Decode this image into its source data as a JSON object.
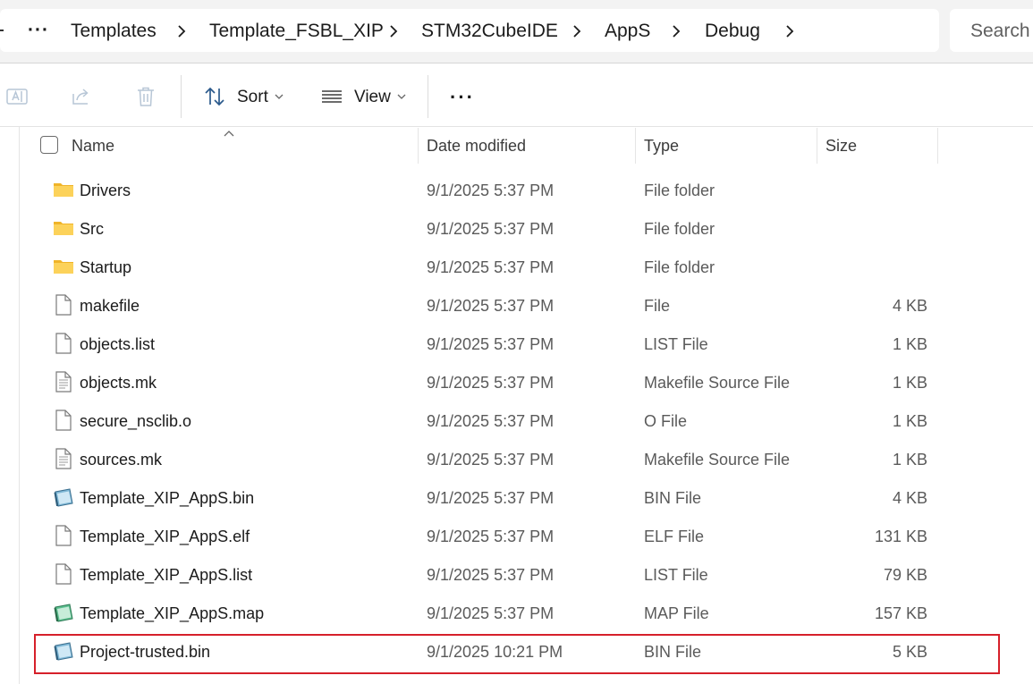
{
  "breadcrumb": {
    "more": "···",
    "items": [
      "Templates",
      "Template_FSBL_XIP",
      "STM32CubeIDE",
      "AppS",
      "Debug"
    ]
  },
  "search": {
    "placeholder": "Search I"
  },
  "toolbar": {
    "sort_label": "Sort",
    "view_label": "View",
    "more_label": "···"
  },
  "columns": {
    "name": "Name",
    "date": "Date modified",
    "type": "Type",
    "size": "Size"
  },
  "files": [
    {
      "name": "Drivers",
      "date": "9/1/2025 5:37 PM",
      "type": "File folder",
      "size": "",
      "icon": "folder-icon"
    },
    {
      "name": "Src",
      "date": "9/1/2025 5:37 PM",
      "type": "File folder",
      "size": "",
      "icon": "folder-icon"
    },
    {
      "name": "Startup",
      "date": "9/1/2025 5:37 PM",
      "type": "File folder",
      "size": "",
      "icon": "folder-icon"
    },
    {
      "name": "makefile",
      "date": "9/1/2025 5:37 PM",
      "type": "File",
      "size": "4 KB",
      "icon": "file-icon"
    },
    {
      "name": "objects.list",
      "date": "9/1/2025 5:37 PM",
      "type": "LIST File",
      "size": "1 KB",
      "icon": "file-icon"
    },
    {
      "name": "objects.mk",
      "date": "9/1/2025 5:37 PM",
      "type": "Makefile Source File",
      "size": "1 KB",
      "icon": "text-file-icon"
    },
    {
      "name": "secure_nsclib.o",
      "date": "9/1/2025 5:37 PM",
      "type": "O File",
      "size": "1 KB",
      "icon": "file-icon"
    },
    {
      "name": "sources.mk",
      "date": "9/1/2025 5:37 PM",
      "type": "Makefile Source File",
      "size": "1 KB",
      "icon": "text-file-icon"
    },
    {
      "name": "Template_XIP_AppS.bin",
      "date": "9/1/2025 5:37 PM",
      "type": "BIN File",
      "size": "4 KB",
      "icon": "bin-file-icon"
    },
    {
      "name": "Template_XIP_AppS.elf",
      "date": "9/1/2025 5:37 PM",
      "type": "ELF File",
      "size": "131 KB",
      "icon": "file-icon"
    },
    {
      "name": "Template_XIP_AppS.list",
      "date": "9/1/2025 5:37 PM",
      "type": "LIST File",
      "size": "79 KB",
      "icon": "file-icon"
    },
    {
      "name": "Template_XIP_AppS.map",
      "date": "9/1/2025 5:37 PM",
      "type": "MAP File",
      "size": "157 KB",
      "icon": "map-file-icon"
    },
    {
      "name": "Project-trusted.bin",
      "date": "9/1/2025 10:21 PM",
      "type": "BIN File",
      "size": "5 KB",
      "icon": "bin-file-icon"
    }
  ],
  "colors": {
    "highlight": "#d6202a",
    "folder": "#f8c33a"
  }
}
